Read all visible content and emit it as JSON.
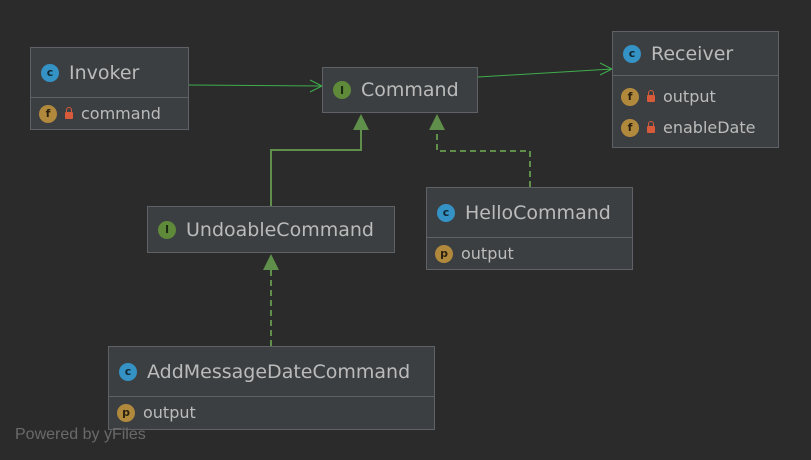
{
  "diagram": {
    "nodes": {
      "invoker": {
        "title": "Invoker",
        "kind": "class",
        "kind_letter": "c",
        "members": [
          {
            "badge": "f",
            "locked": true,
            "name": "command"
          }
        ]
      },
      "command": {
        "title": "Command",
        "kind": "interface",
        "kind_letter": "I",
        "members": []
      },
      "receiver": {
        "title": "Receiver",
        "kind": "class",
        "kind_letter": "c",
        "members": [
          {
            "badge": "f",
            "locked": true,
            "name": "output"
          },
          {
            "badge": "f",
            "locked": true,
            "name": "enableDate"
          }
        ]
      },
      "undoable": {
        "title": "UndoableCommand",
        "kind": "interface",
        "kind_letter": "I",
        "members": []
      },
      "hello": {
        "title": "HelloCommand",
        "kind": "class",
        "kind_letter": "c",
        "members": [
          {
            "badge": "p",
            "locked": false,
            "name": "output"
          }
        ]
      },
      "addmessage": {
        "title": "AddMessageDateCommand",
        "kind": "class",
        "kind_letter": "c",
        "members": [
          {
            "badge": "p",
            "locked": false,
            "name": "output"
          }
        ]
      }
    },
    "colors": {
      "association": "#3fae4c",
      "realization": "#5f8f4a",
      "generalization": "#5f8f4a"
    }
  },
  "watermark": "Powered by yFiles"
}
